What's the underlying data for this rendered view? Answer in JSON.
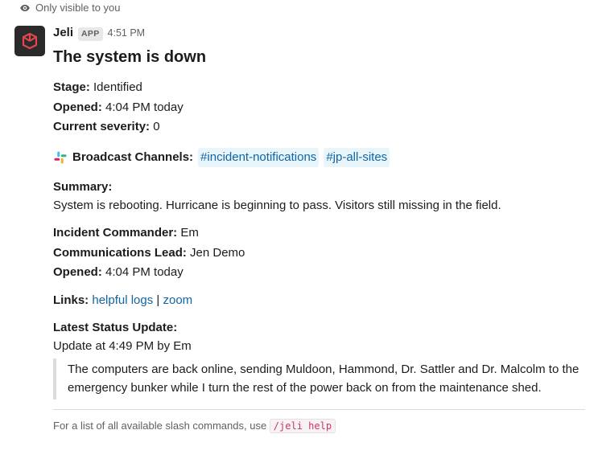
{
  "visibility_text": "Only visible to you",
  "sender": {
    "name": "Jeli",
    "badge": "APP",
    "timestamp": "4:51 PM"
  },
  "headline": "The system is down",
  "fields": {
    "stage_label": "Stage:",
    "stage_value": "Identified",
    "opened_label": "Opened:",
    "opened_value": "4:04 PM today",
    "severity_label": "Current severity:",
    "severity_value": "0",
    "broadcast_label": "Broadcast Channels:",
    "channels": [
      "#incident-notifications",
      "#jp-all-sites"
    ],
    "summary_label": "Summary:",
    "summary_value": "System is rebooting. Hurricane is beginning to pass. Visitors still missing in the field.",
    "commander_label": "Incident Commander:",
    "commander_value": "Em",
    "comms_label": "Communications Lead:",
    "comms_value": "Jen Demo",
    "opened2_label": "Opened:",
    "opened2_value": "4:04 PM today",
    "links_label": "Links:",
    "link1": "helpful logs",
    "link2": "zoom",
    "status_label": "Latest Status Update:",
    "status_meta": "Update at 4:49 PM by Em",
    "status_body": "The computers are back online, sending Muldoon, Hammond, Dr. Sattler and Dr. Malcolm to the emergency bunker while I turn the rest of the power back on from the maintenance shed."
  },
  "footer": {
    "prefix": "For a list of all available slash commands, use ",
    "command": "/jeli help"
  }
}
